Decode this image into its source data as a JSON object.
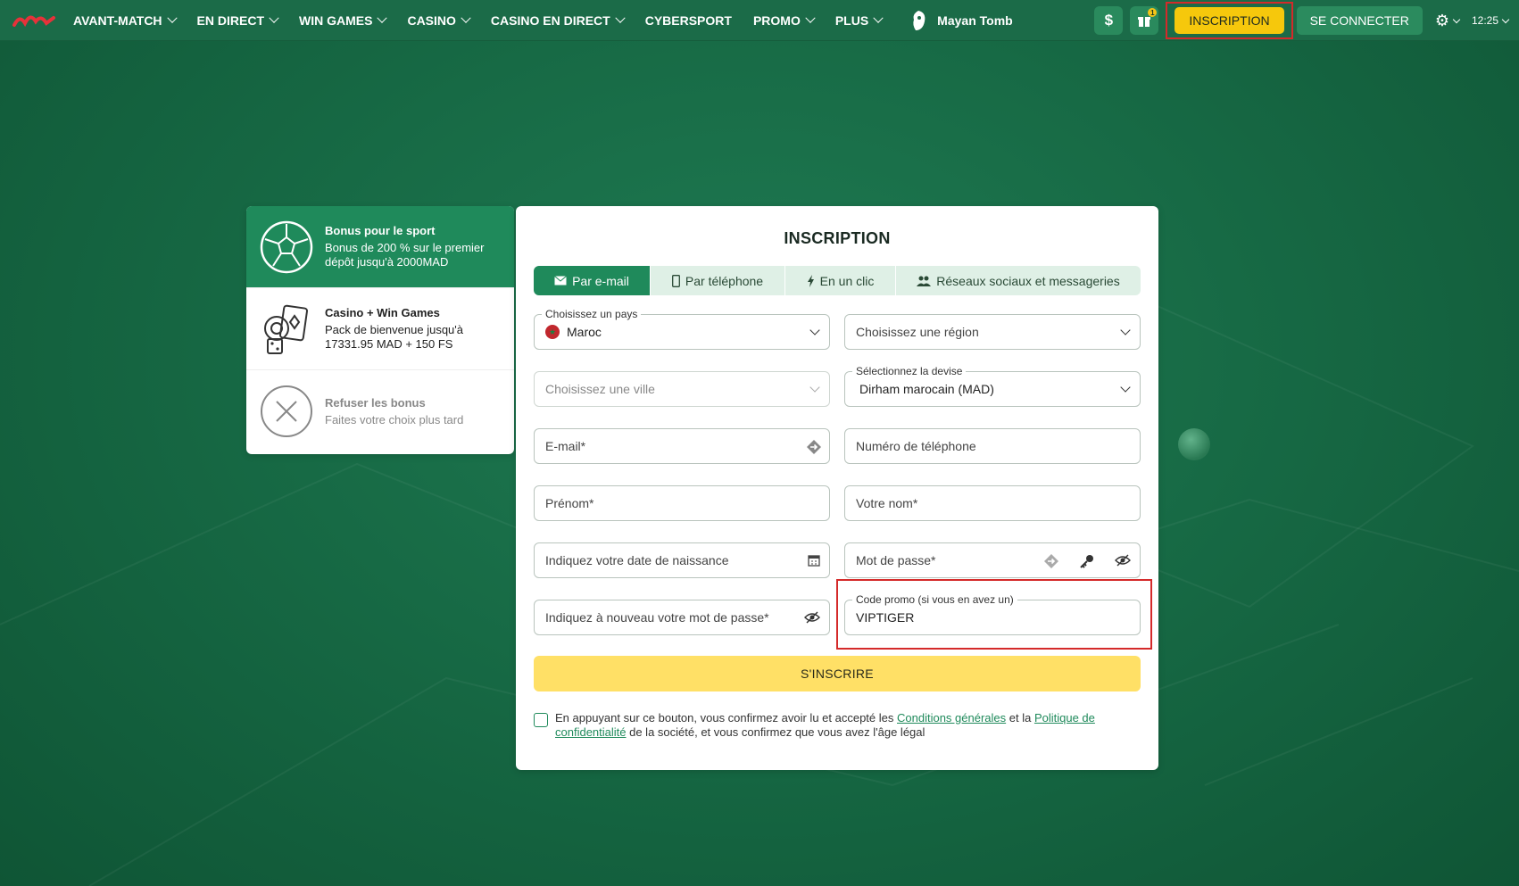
{
  "nav": {
    "items": [
      {
        "label": "AVANT-MATCH",
        "dropdown": true
      },
      {
        "label": "EN DIRECT",
        "dropdown": true
      },
      {
        "label": "WIN GAMES",
        "dropdown": true
      },
      {
        "label": "CASINO",
        "dropdown": true
      },
      {
        "label": "CASINO EN DIRECT",
        "dropdown": true
      },
      {
        "label": "CYBERSPORT",
        "dropdown": false
      },
      {
        "label": "PROMO",
        "dropdown": true
      },
      {
        "label": "PLUS",
        "dropdown": true
      }
    ],
    "featured_game": "Mayan Tomb"
  },
  "header": {
    "dollar_icon": "$",
    "gift_badge": "1",
    "signup_label": "INSCRIPTION",
    "login_label": "SE CONNECTER",
    "time": "12:25"
  },
  "bonus": {
    "items": [
      {
        "title": "Bonus pour le sport",
        "desc": "Bonus de 200 % sur le premier dépôt jusqu'à 2000MAD"
      },
      {
        "title": "Casino + Win Games",
        "desc": "Pack de bienvenue jusqu'à 17331.95 MAD + 150 FS"
      },
      {
        "title": "Refuser les bonus",
        "desc": "Faites votre choix plus tard"
      }
    ]
  },
  "form": {
    "title": "INSCRIPTION",
    "tabs": [
      {
        "label": "Par e-mail",
        "icon": "envelope-icon"
      },
      {
        "label": "Par téléphone",
        "icon": "phone-icon"
      },
      {
        "label": "En un clic",
        "icon": "lightning-icon"
      },
      {
        "label": "Réseaux sociaux et messageries",
        "icon": "users-icon"
      }
    ],
    "country_label": "Choisissez un pays",
    "country_value": "Maroc",
    "region_placeholder": "Choisissez une région",
    "city_placeholder": "Choisissez une ville",
    "currency_label": "Sélectionnez la devise",
    "currency_value": "Dirham marocain (MAD)",
    "email_placeholder": "E-mail*",
    "phone_placeholder": "Numéro de téléphone",
    "firstname_placeholder": "Prénom*",
    "lastname_placeholder": "Votre nom*",
    "birthdate_placeholder": "Indiquez votre date de naissance",
    "password_placeholder": "Mot de passe*",
    "password_repeat_placeholder": "Indiquez à nouveau votre mot de passe*",
    "promo_label": "Code promo (si vous en avez un)",
    "promo_value": "VIPTIGER",
    "submit_label": "S'INSCRIRE",
    "consent": {
      "before": "En appuyant sur ce bouton, vous confirmez avoir lu et accepté les ",
      "terms_link": "Conditions générales",
      "middle": " et la ",
      "privacy_link": "Politique de confidentialité",
      "after": " de la société, et vous confirmez que vous avez l'âge légal"
    }
  },
  "colors": {
    "brand_green": "#1f8a5b",
    "cta_yellow": "#f6c80c",
    "submit_yellow": "#ffe066",
    "highlight_red": "#d42a2a"
  }
}
